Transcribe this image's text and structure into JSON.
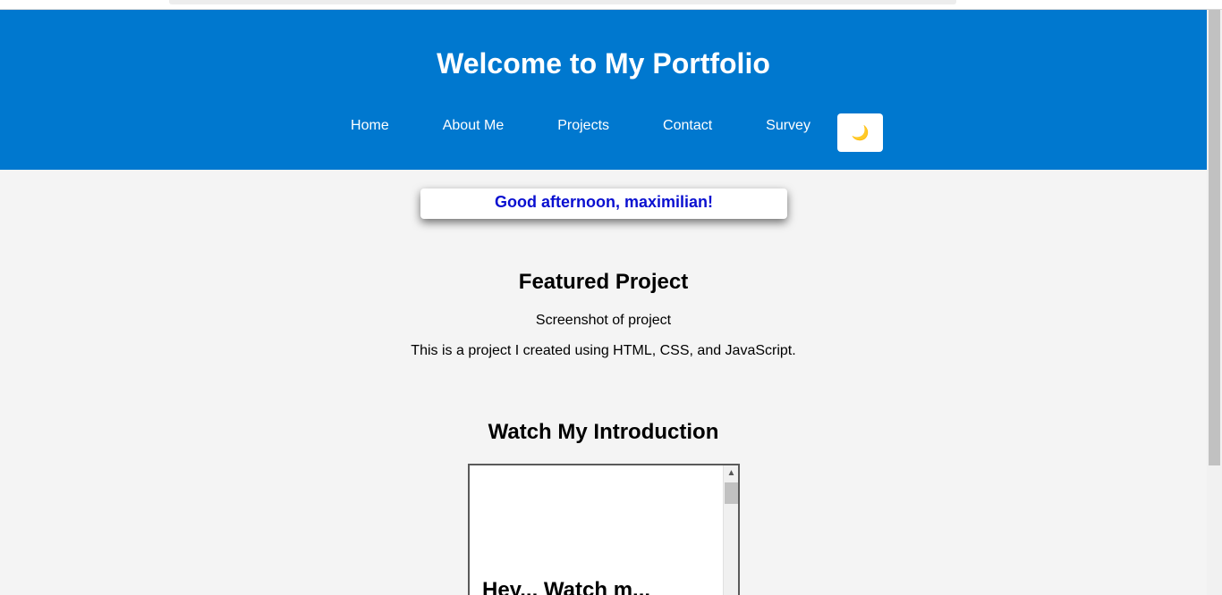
{
  "header": {
    "title": "Welcome to My Portfolio",
    "nav": [
      "Home",
      "About Me",
      "Projects",
      "Contact",
      "Survey"
    ],
    "theme_toggle_icon": "🌙"
  },
  "greeting": "Good afternoon, maximilian!",
  "featured": {
    "title": "Featured Project",
    "image_alt": "Screenshot of project",
    "description": "This is a project I created using HTML, CSS, and JavaScript."
  },
  "intro": {
    "title": "Watch My Introduction",
    "frame_text": "Hey... Watch m..."
  },
  "colors": {
    "header_bg": "#0078cf",
    "greeting_text": "#0a10d0",
    "page_bg": "#f4f4f4"
  }
}
